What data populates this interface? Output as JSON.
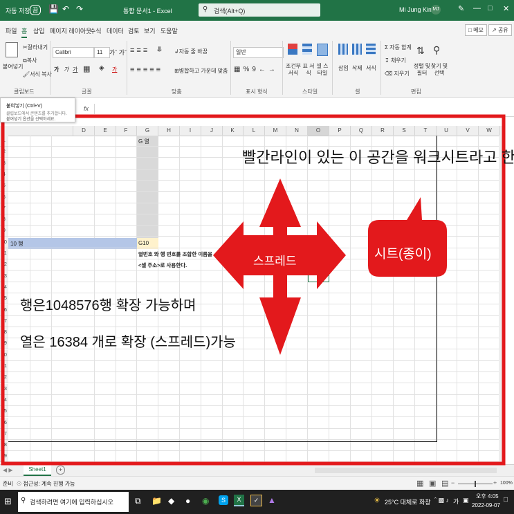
{
  "titlebar": {
    "autosave": "자동 저장",
    "autosave_state": "끔",
    "title": "통합 문서1 - Excel",
    "search_placeholder": "검색(Alt+Q)",
    "user_name": "Mi Jung Kim",
    "user_initials": "MJ"
  },
  "menu": {
    "tabs": [
      "파일",
      "홈",
      "삽입",
      "페이지 레이아웃",
      "수식",
      "데이터",
      "검토",
      "보기",
      "도움말"
    ],
    "active_tab": "홈",
    "memo_label": "메모",
    "share_label": "공유"
  },
  "ribbon": {
    "paste_label": "붙여넣기",
    "cut_label": "잘라내기",
    "copy_label": "복사",
    "format_painter_label": "서식 복사",
    "clipboard_group": "클립보드",
    "font_name": "Calibri",
    "font_size": "11",
    "font_group": "글꼴",
    "wrap_text_label": "자동 줄 바꿈",
    "merge_label": "병합하고 가운데 맞춤",
    "align_group": "맞춤",
    "number_format": "일반",
    "number_group": "표시 형식",
    "conditional_format_label": "조건부 서식",
    "table_format_label": "표 서식",
    "cell_style_label": "셀 스타일",
    "style_group": "스타일",
    "insert_label": "삽입",
    "delete_label": "삭제",
    "format_label": "서식",
    "cells_group": "셀",
    "autosum_label": "자동 합계",
    "fill_label": "채우기",
    "clear_label": "지우기",
    "sort_filter_label": "정렬 및 필터",
    "find_select_label": "찾기 및 선택",
    "editing_group": "편집"
  },
  "tooltip": {
    "title": "붙여넣기 (Ctrl+V)",
    "line1": "클립보드에서 콘텐츠를 추가합니다.",
    "line2": "붙여넣기 옵션을 선택하세요."
  },
  "formula": {
    "fx": "fx"
  },
  "columns": [
    "D",
    "E",
    "F",
    "G",
    "H",
    "I",
    "J",
    "K",
    "L",
    "M",
    "N",
    "O",
    "P",
    "Q",
    "R",
    "S",
    "T",
    "U",
    "V",
    "W"
  ],
  "rows": [
    "1",
    "2",
    "3",
    "4",
    "5",
    "6",
    "7",
    "8",
    "9",
    "10",
    "11",
    "12",
    "13",
    "14",
    "15",
    "16",
    "17",
    "18",
    "19",
    "20",
    "21",
    "22",
    "23",
    "24",
    "25",
    "26",
    "27",
    "28",
    "29"
  ],
  "cells": {
    "g1": "G 열",
    "row10_label": "10 행",
    "g10": "G10",
    "g11": "열번호 와 행 번호를 조합한 이름을",
    "g12": "<셀 주소>로 사용한다."
  },
  "annotations": {
    "worksheet_caption": "빨간라인이 있는 이 공간을 워크시트라고 한다",
    "spread_label": "스프레드",
    "sheet_callout": "시트(종이)",
    "rows_text": "행은1048576행 확장 가능하며",
    "cols_text": "열은 16384 개로 확장 (스프레드)가능"
  },
  "colors": {
    "excel_green": "#217346",
    "annotation_red": "#e3191c",
    "selected_row": "#b4c6e7",
    "selected_col": "#d9d9d9"
  },
  "sheets": {
    "tab1": "Sheet1",
    "add": "+"
  },
  "status": {
    "ready": "준비",
    "accessibility": "접근성: 계속 진행 가능",
    "zoom": "100%"
  },
  "taskbar": {
    "search_placeholder": "검색하려면 여기에 입력하십시오",
    "weather": "25°C 대체로 화창",
    "time": "오후 4:05",
    "date": "2022-09-07",
    "lang": "가"
  }
}
